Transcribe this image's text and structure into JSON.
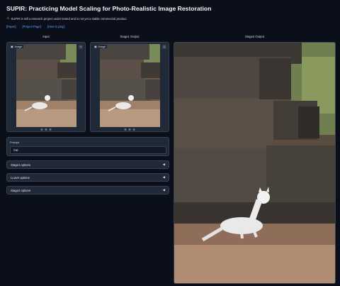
{
  "page": {
    "title": "SUPIR: Practicing Model Scaling for Photo-Realistic Image Restoration",
    "warning": "SUPIR is still a research project under tested and is not yet a stable commercial product.",
    "links": [
      "[Paper]",
      "[Project Page]",
      "[How to play]"
    ]
  },
  "columns": {
    "input": "Input",
    "stage1": "Stage1 Output",
    "stage2": "Stage2 Output"
  },
  "image_panels": {
    "input": {
      "tag": "Image",
      "close": "×"
    },
    "stage1": {
      "tag": "Image",
      "close": "×"
    }
  },
  "prompt": {
    "label": "Prompt",
    "value": "Cat"
  },
  "accordions": [
    {
      "label": "Stage1 options"
    },
    {
      "label": "LLaVA options"
    },
    {
      "label": "Stage2 options"
    }
  ],
  "colors": {
    "background": "#0b0f19",
    "panel": "#1f2937",
    "link": "#60a5fa",
    "warning_icon": "#f59e0b"
  },
  "icons": {
    "warning": "warning-triangle-icon",
    "image": "image-icon",
    "close": "close-icon",
    "collapse": "triangle-left-icon"
  }
}
